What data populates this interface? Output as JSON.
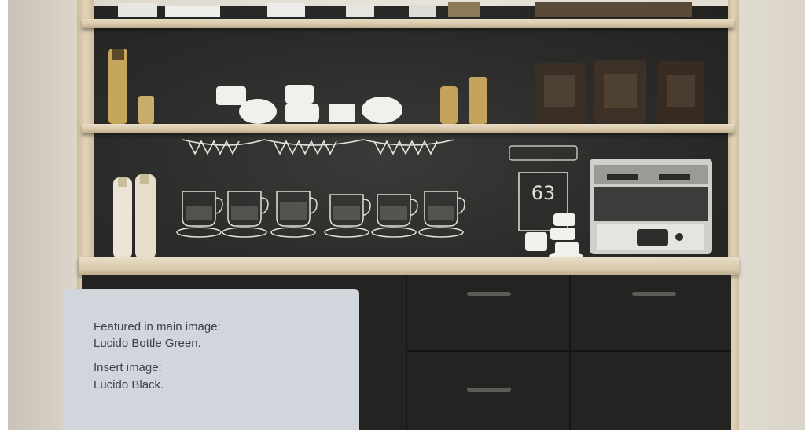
{
  "caption": {
    "featured_heading": "Featured in main image:",
    "featured_name": "Lucido Bottle Green.",
    "insert_heading": "Insert image:",
    "insert_name": "Lucido Black."
  },
  "chalkboard": {
    "sign_number": "63"
  },
  "colors": {
    "caption_background": "#d1d6dd",
    "caption_text": "#3d4146",
    "cabinet": "#232322",
    "wood": "#d7c7a8"
  }
}
